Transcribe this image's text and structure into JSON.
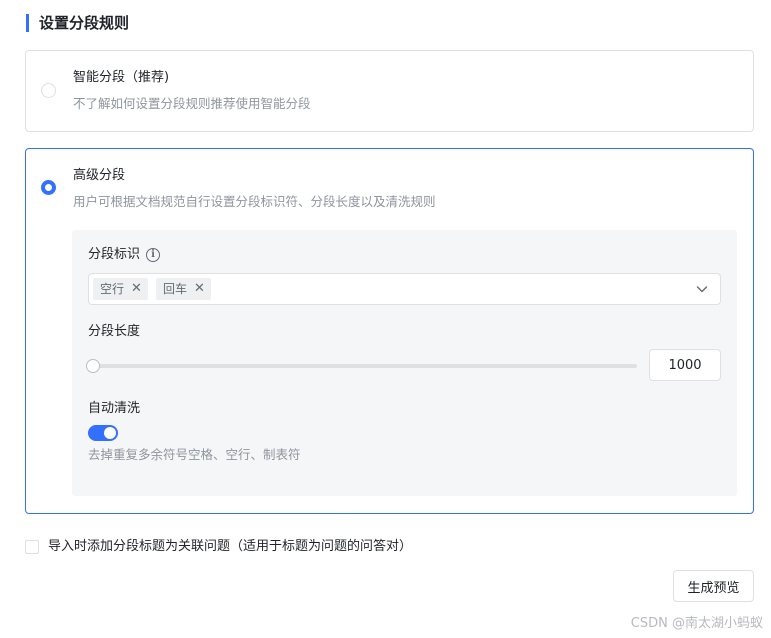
{
  "section": {
    "title": "设置分段规则"
  },
  "options": {
    "smart": {
      "title": "智能分段（推荐)",
      "description": "不了解如何设置分段规则推荐使用智能分段",
      "selected": false
    },
    "advanced": {
      "title": "高级分段",
      "description": "用户可根据文档规范自行设置分段标识符、分段长度以及清洗规则",
      "selected": true
    }
  },
  "advanced_panel": {
    "separator": {
      "label": "分段标识",
      "info_icon": "info-icon",
      "tags": [
        {
          "label": "空行"
        },
        {
          "label": "回车"
        }
      ],
      "dropdown_icon": "chevron-down-icon"
    },
    "length": {
      "label": "分段长度",
      "value": "1000",
      "slider_fraction": 0.0
    },
    "auto_clean": {
      "label": "自动清洗",
      "enabled": true,
      "description": "去掉重复多余符号空格、空行、制表符"
    }
  },
  "import_option": {
    "label": "导入时添加分段标题为关联问题（适用于标题为问题的问答对）",
    "checked": false
  },
  "actions": {
    "preview_label": "生成预览"
  },
  "watermark": "CSDN @南太湖小蚂蚁",
  "colors": {
    "accent": "#3370ff",
    "border": "#dee0e3",
    "panel_bg": "#f5f6f7",
    "muted_text": "#8f959e"
  }
}
